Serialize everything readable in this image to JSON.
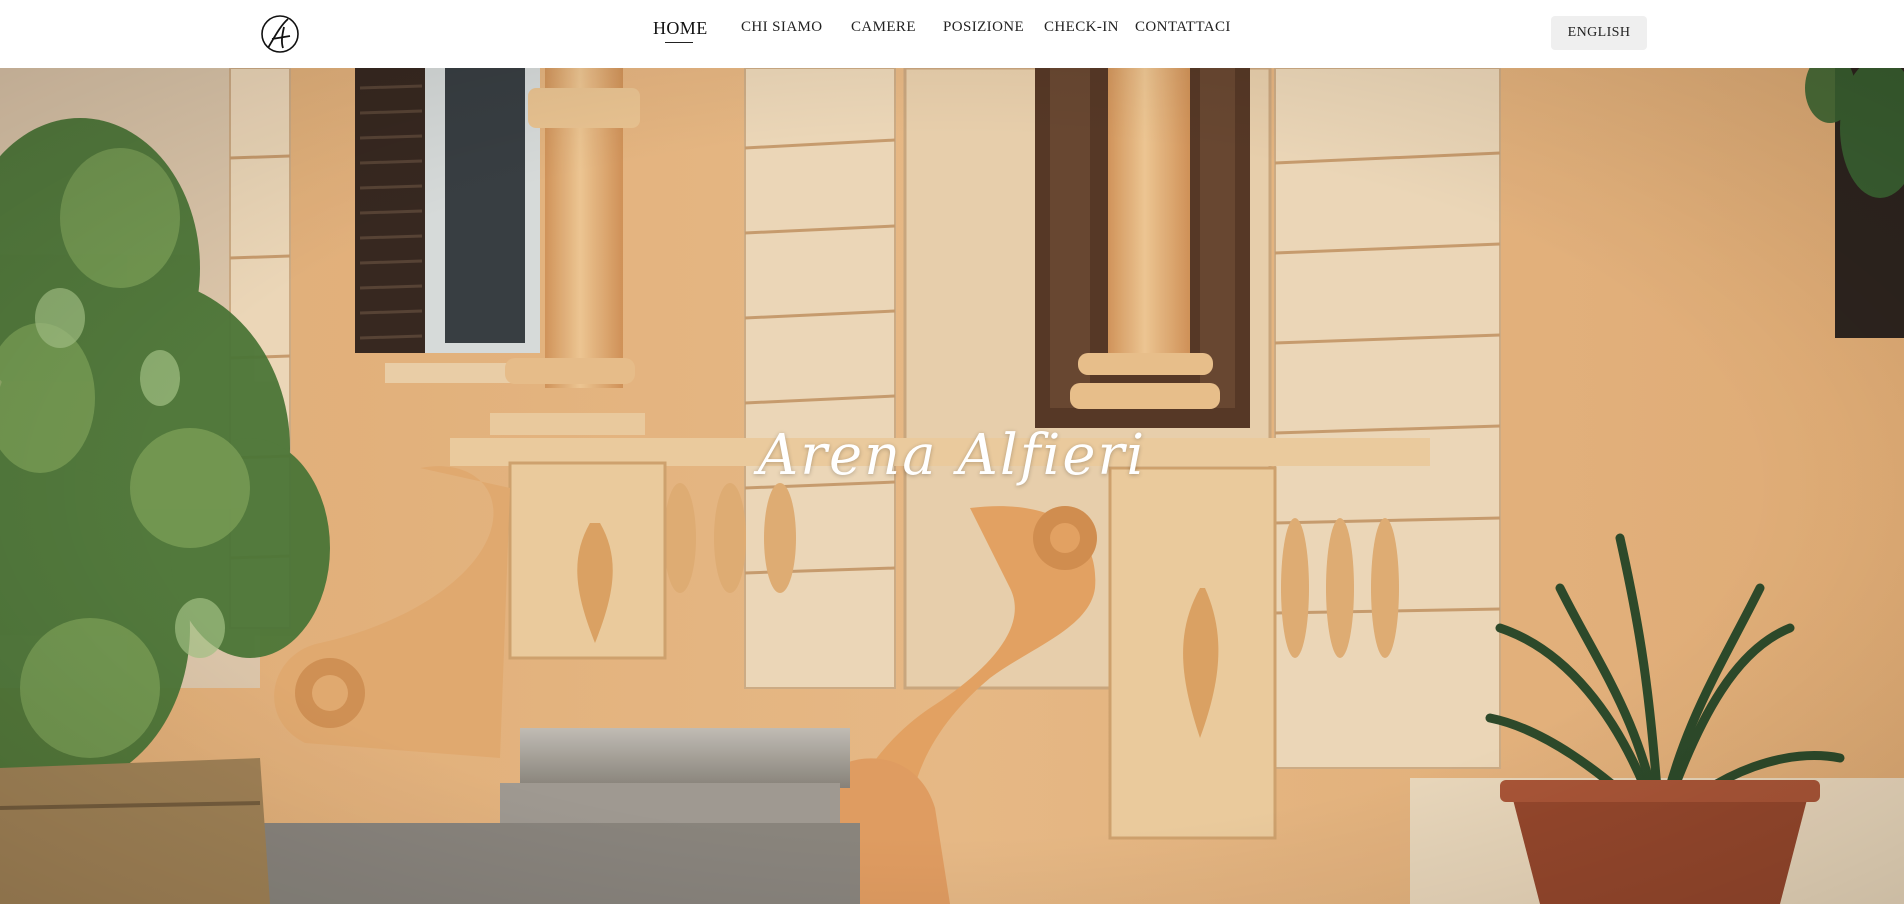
{
  "brand": {
    "logo_icon": "monogram-a-icon"
  },
  "nav": {
    "items": [
      {
        "label": "HOME",
        "active": true
      },
      {
        "label": "CHI SIAMO"
      },
      {
        "label": "CAMERE"
      },
      {
        "label": "POSIZIONE"
      },
      {
        "label": "CHECK-IN"
      },
      {
        "label": "CONTATTACI"
      }
    ]
  },
  "language_button": {
    "label": "ENGLISH"
  },
  "hero": {
    "title": "Arena Alfieri"
  },
  "colors": {
    "wall": "#eab87f",
    "column": "#f2c48e",
    "pilaster": "#f6e2c3",
    "shutter": "#3a2a22",
    "foliage": "#4f7a3a",
    "pot": "#9b4a2e",
    "button_bg": "#efefef"
  }
}
